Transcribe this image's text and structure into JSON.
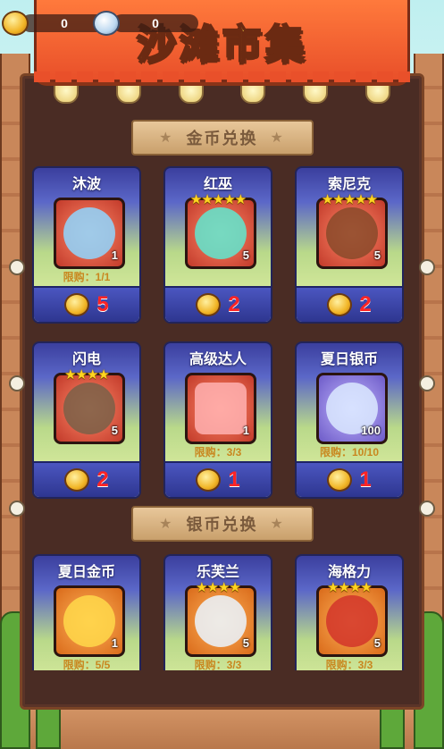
{
  "header": {
    "title": "沙滩市集",
    "gold_amount": "0",
    "silver_amount": "0"
  },
  "sections": [
    {
      "label": "金币兑换",
      "items": [
        {
          "name": "沐波",
          "stars": "",
          "count": "1",
          "limit": "限购：1/1",
          "price": "5",
          "portrait": "water-hero-icon",
          "bg": "p-red"
        },
        {
          "name": "红巫",
          "stars": "★★★★★",
          "count": "5",
          "limit": "",
          "price": "2",
          "portrait": "crystal-creature-icon",
          "bg": "p-red"
        },
        {
          "name": "索尼克",
          "stars": "★★★★★",
          "count": "5",
          "limit": "",
          "price": "2",
          "portrait": "hedgehog-icon",
          "bg": "p-red"
        },
        {
          "name": "闪电",
          "stars": "★★★★",
          "count": "5",
          "limit": "",
          "price": "2",
          "portrait": "sloth-icon",
          "bg": "p-red"
        },
        {
          "name": "高级达人",
          "stars": "",
          "count": "1",
          "limit": "限购：3/3",
          "price": "1",
          "portrait": "red-gem-icon",
          "bg": "p-red"
        },
        {
          "name": "夏日银币",
          "stars": "",
          "count": "100",
          "limit": "限购：10/10",
          "price": "1",
          "portrait": "silver-shell-icon",
          "bg": "p-purple"
        }
      ]
    },
    {
      "label": "银币兑换",
      "items": [
        {
          "name": "夏日金币",
          "stars": "",
          "count": "1",
          "limit": "限购：5/5",
          "portrait": "gold-shell-icon",
          "bg": "p-orange"
        },
        {
          "name": "乐芙兰",
          "stars": "★★★★",
          "count": "5",
          "limit": "限购：3/3",
          "portrait": "cloud-spirit-icon",
          "bg": "p-orange"
        },
        {
          "name": "海格力",
          "stars": "★★★★",
          "count": "5",
          "limit": "限购：3/3",
          "portrait": "red-monster-icon",
          "bg": "p-orange"
        }
      ]
    }
  ],
  "colors": {
    "accent_red": "#ff2424",
    "title_yellow": "#ffe14a",
    "banner_orange": "#e9502a"
  }
}
